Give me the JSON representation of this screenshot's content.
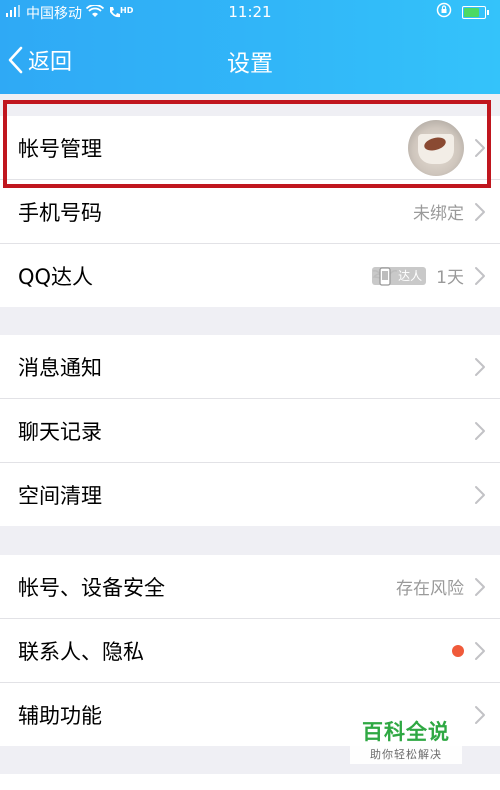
{
  "status_bar": {
    "carrier": "中国移动",
    "hd": "HD",
    "time": "11:21"
  },
  "nav": {
    "back_label": "返回",
    "title": "设置"
  },
  "groups": [
    {
      "items": [
        {
          "label": "帐号管理",
          "value": "",
          "right": "avatar"
        },
        {
          "label": "手机号码",
          "value": "未绑定",
          "right": "text"
        },
        {
          "label": "QQ达人",
          "badge": "达人",
          "value": "1天",
          "right": "badge"
        }
      ]
    },
    {
      "items": [
        {
          "label": "消息通知",
          "value": ""
        },
        {
          "label": "聊天记录",
          "value": ""
        },
        {
          "label": "空间清理",
          "value": ""
        }
      ]
    },
    {
      "items": [
        {
          "label": "帐号、设备安全",
          "value": "存在风险"
        },
        {
          "label": "联系人、隐私",
          "value": "",
          "right": "dot"
        },
        {
          "label": "辅助功能",
          "value": ""
        }
      ]
    }
  ],
  "colors": {
    "header": "#31b6f8",
    "highlight": "#c0161e",
    "red_dot": "#f05a3a"
  },
  "watermark": {
    "title": "百科全说",
    "subtitle": "助你轻松解决"
  }
}
